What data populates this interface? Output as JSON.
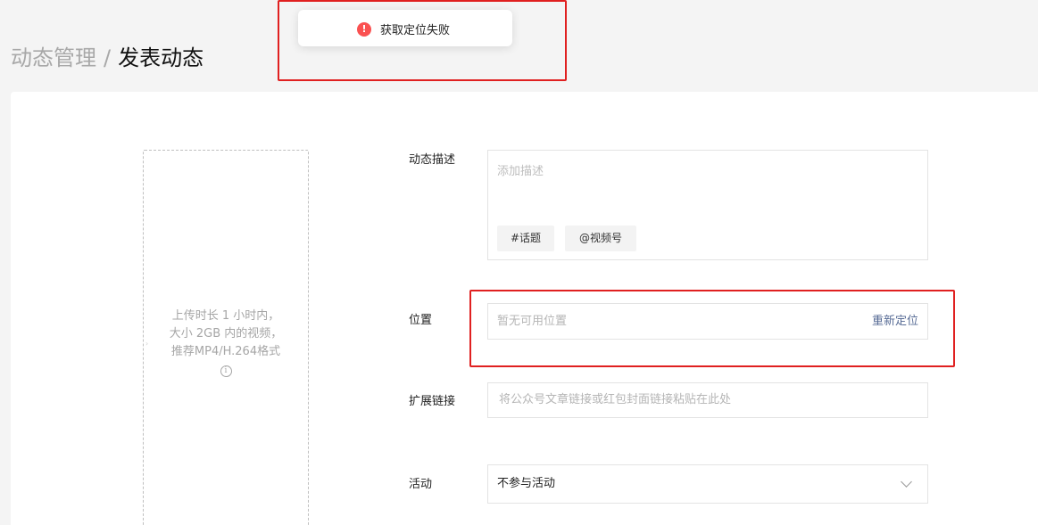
{
  "breadcrumb": {
    "parent": "动态管理",
    "separator": "/",
    "current": "发表动态"
  },
  "toast": {
    "icon": "alert-circle-icon",
    "message": "获取定位失败",
    "icon_color": "#fa5151"
  },
  "upload": {
    "hint_lines": [
      "上传时长 1 小时内，",
      "大小 2GB 内的视频，",
      "推荐MP4/H.264格式"
    ],
    "info_icon": "i"
  },
  "form": {
    "description": {
      "label": "动态描述",
      "placeholder": "添加描述",
      "topic_button": "#话题",
      "mention_button": "@视频号"
    },
    "location": {
      "label": "位置",
      "placeholder": "暂无可用位置",
      "relocate_label": "重新定位"
    },
    "extended_link": {
      "label": "扩展链接",
      "placeholder": "将公众号文章链接或红包封面链接粘贴在此处"
    },
    "activity": {
      "label": "活动",
      "value": "不参与活动"
    }
  },
  "colors": {
    "highlight": "#e02020",
    "link": "#576b95",
    "background": "#f4f4f4"
  }
}
